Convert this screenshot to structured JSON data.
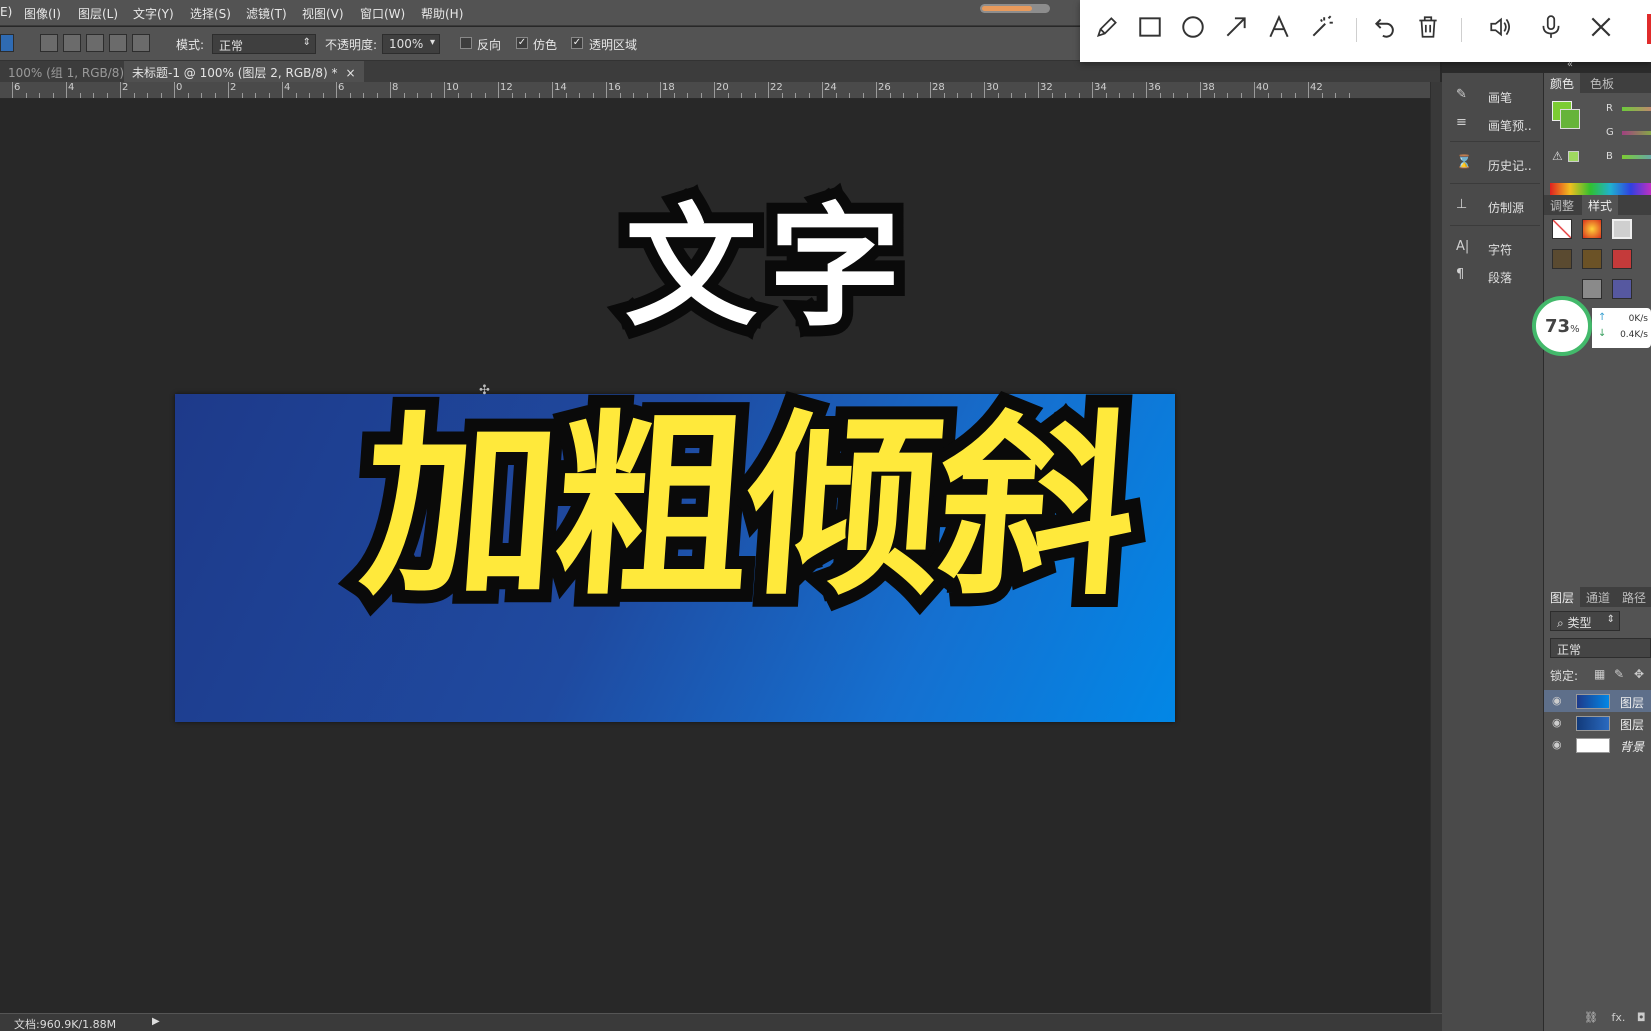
{
  "menubar": {
    "items": [
      "E)",
      "图像(I)",
      "图层(L)",
      "文字(Y)",
      "选择(S)",
      "滤镜(T)",
      "视图(V)",
      "窗口(W)",
      "帮助(H)"
    ],
    "progress": 0.75
  },
  "options": {
    "mode_label": "模式:",
    "mode_value": "正常",
    "opacity_label": "不透明度:",
    "opacity_value": "100%",
    "reverse_label": "反向",
    "dither_label": "仿色",
    "transparency_label": "透明区域"
  },
  "tabs": {
    "tab1": "100% (组 1, RGB/8)",
    "tab2": "未标题-1 @ 100% (图层 2, RGB/8) *",
    "close": "×"
  },
  "ruler": {
    "ticks": [
      "6",
      "4",
      "2",
      "0",
      "2",
      "4",
      "6",
      "8",
      "10",
      "12",
      "14",
      "16",
      "18",
      "20",
      "22",
      "24",
      "26",
      "28",
      "30",
      "32",
      "34",
      "36",
      "38",
      "40",
      "42"
    ]
  },
  "canvas": {
    "title_text": "文字",
    "effect_text": "加粗倾斜",
    "title_fill": "#ffffff",
    "effect_fill": "#ffe93b",
    "stroke": "#0a0a0a",
    "gradient_start": "#1e3a8a",
    "gradient_end": "#0287e6"
  },
  "status": {
    "doc": "文档:960.9K/1.88M",
    "arrow": "▶"
  },
  "midpanel": {
    "items": [
      "画笔",
      "画笔预..",
      "历史记..",
      "仿制源",
      "字符",
      "段落"
    ]
  },
  "rightpanel": {
    "color_tab": "颜色",
    "swatches_tab": "色板",
    "r": "R",
    "g": "G",
    "b": "B",
    "adjust_tab": "调整",
    "styles_tab": "样式",
    "layers_tab": "图层",
    "channels_tab": "通道",
    "paths_tab": "路径",
    "kind_label": "类型",
    "blend_value": "正常",
    "lock_label": "锁定:",
    "layers": [
      "图层",
      "图层",
      "背景"
    ],
    "foreground_color": "#7ccc32",
    "background_color": "#66b43a"
  },
  "network": {
    "percent": "73",
    "percent_sign": "%",
    "up": "0K/s",
    "down": "0.4K/s"
  },
  "annotation_toolbar": {
    "tools": [
      "pencil-icon",
      "rectangle-icon",
      "circle-icon",
      "arrow-icon",
      "text-icon",
      "magic-wand-icon",
      "undo-icon",
      "trash-icon",
      "speaker-icon",
      "microphone-icon",
      "close-icon"
    ]
  }
}
